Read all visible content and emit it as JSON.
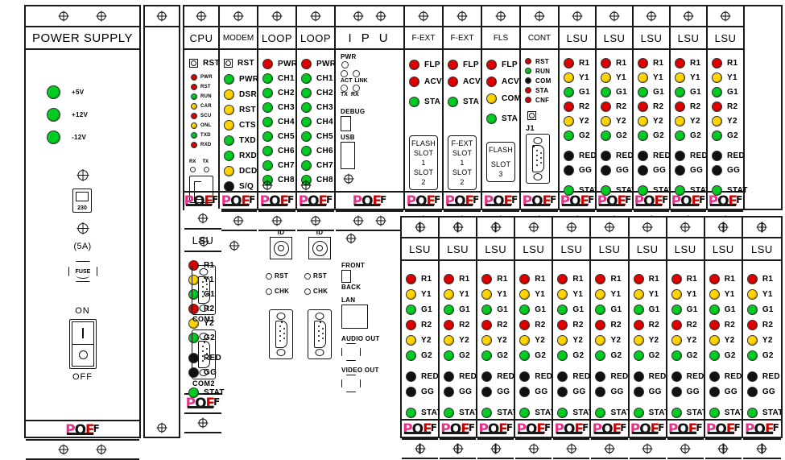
{
  "panel": {
    "brand_logo": {
      "p": "P",
      "o": "O",
      "e": "E",
      "f": "F"
    },
    "screw_icon": "screw-cross-icon"
  },
  "power_supply": {
    "title": "POWER SUPPLY",
    "leds": [
      {
        "label": "+5V",
        "color": "green"
      },
      {
        "label": "+12V",
        "color": "green"
      },
      {
        "label": "-12V",
        "color": "green"
      }
    ],
    "voltage_selector": {
      "value": "230"
    },
    "fuse": {
      "rating": "(5A)",
      "label": "FUSE"
    },
    "switch": {
      "on_label": "ON",
      "off_label": "OFF"
    }
  },
  "top_row": {
    "cpu": {
      "title": "CPU",
      "reset_label": "RST",
      "leds": [
        {
          "label": "PWR",
          "color": "red"
        },
        {
          "label": "RST",
          "color": "red"
        },
        {
          "label": "RUN",
          "color": "green"
        },
        {
          "label": "CAR",
          "color": "yellow"
        },
        {
          "label": "SCU",
          "color": "red"
        },
        {
          "label": "ONL",
          "color": "yellow"
        },
        {
          "label": "TXD",
          "color": "green"
        },
        {
          "label": "RXD",
          "color": "red"
        }
      ],
      "rx_label": "RX",
      "tx_label": "TX",
      "ethernet_port": "RJ45",
      "com1_label": "COM1",
      "com2_label": "COM2"
    },
    "modem": {
      "title": "MODEM",
      "reset_label": "RST",
      "leds": [
        {
          "label": "PWR",
          "color": "green"
        },
        {
          "label": "DSR",
          "color": "yellow"
        },
        {
          "label": "RST",
          "color": "yellow"
        },
        {
          "label": "CTS",
          "color": "yellow"
        },
        {
          "label": "TXD",
          "color": "green"
        },
        {
          "label": "RXD",
          "color": "green"
        },
        {
          "label": "DCD",
          "color": "yellow"
        },
        {
          "label": "S/Q",
          "color": "black"
        }
      ]
    },
    "loop1": {
      "title": "LOOP",
      "leds": [
        {
          "label": "PWR",
          "color": "red"
        },
        {
          "label": "CH1",
          "color": "green"
        },
        {
          "label": "CH2",
          "color": "green"
        },
        {
          "label": "CH3",
          "color": "green"
        },
        {
          "label": "CH4",
          "color": "green"
        },
        {
          "label": "CH5",
          "color": "green"
        },
        {
          "label": "CH6",
          "color": "green"
        },
        {
          "label": "CH7",
          "color": "green"
        },
        {
          "label": "CH8",
          "color": "green"
        }
      ],
      "id_label": "ID",
      "rst_label": "RST",
      "chk_label": "CHK"
    },
    "loop2": {
      "title": "LOOP",
      "leds": [
        {
          "label": "PWR",
          "color": "red"
        },
        {
          "label": "CH1",
          "color": "green"
        },
        {
          "label": "CH2",
          "color": "green"
        },
        {
          "label": "CH3",
          "color": "green"
        },
        {
          "label": "CH4",
          "color": "green"
        },
        {
          "label": "CH5",
          "color": "green"
        },
        {
          "label": "CH6",
          "color": "green"
        },
        {
          "label": "CH7",
          "color": "green"
        },
        {
          "label": "CH8",
          "color": "green"
        }
      ],
      "id_label": "ID",
      "rst_label": "RST",
      "chk_label": "CHK"
    },
    "ipu": {
      "title": "I P U",
      "pwr_label": "PWR",
      "act_label": "ACT",
      "link_label": "LINK",
      "tx_label": "TX",
      "rx_label": "RX",
      "debug_label": "DEBUG",
      "usb_label": "USB",
      "front_label": "FRONT",
      "back_label": "BACK",
      "lan_label": "LAN",
      "audio_out_label": "AUDIO OUT",
      "video_out_label": "VIDEO OUT"
    },
    "fext1": {
      "title": "F-EXT",
      "leds": [
        {
          "label": "FLP",
          "color": "red"
        },
        {
          "label": "ACV",
          "color": "red"
        },
        {
          "label": "STA",
          "color": "green"
        }
      ],
      "slot_lines": [
        "FLASH",
        "SLOT 1",
        "SLOT 2"
      ]
    },
    "fext2": {
      "title": "F-EXT",
      "leds": [
        {
          "label": "FLP",
          "color": "red"
        },
        {
          "label": "ACV",
          "color": "red"
        },
        {
          "label": "STA",
          "color": "green"
        }
      ],
      "slot_lines": [
        "F-EXT",
        "SLOT 1",
        "SLOT 2"
      ]
    },
    "fls": {
      "title": "FLS",
      "leds": [
        {
          "label": "FLP",
          "color": "red"
        },
        {
          "label": "ACV",
          "color": "red"
        },
        {
          "label": "COM",
          "color": "yellow"
        },
        {
          "label": "STA",
          "color": "green"
        }
      ],
      "slot_lines": [
        "FLASH",
        "SLOT 3"
      ]
    },
    "cont": {
      "title": "CONT",
      "leds": [
        {
          "label": "RST",
          "color": "red"
        },
        {
          "label": "RUN",
          "color": "green"
        },
        {
          "label": "COM",
          "color": "black"
        },
        {
          "label": "STA",
          "color": "red"
        },
        {
          "label": "CNF",
          "color": "red"
        }
      ],
      "connector_label": "J1"
    },
    "lsu_count": 6
  },
  "bottom_row": {
    "lsu_count": 10
  },
  "lsu_template": {
    "title": "LSU",
    "leds": [
      {
        "label": "R1",
        "color": "red"
      },
      {
        "label": "Y1",
        "color": "yellow"
      },
      {
        "label": "G1",
        "color": "green"
      },
      {
        "label": "R2",
        "color": "red"
      },
      {
        "label": "Y2",
        "color": "yellow"
      },
      {
        "label": "G2",
        "color": "green"
      },
      {
        "label": "RED",
        "color": "black"
      },
      {
        "label": "GG",
        "color": "black"
      },
      {
        "label": "STAT",
        "color": "green"
      }
    ]
  },
  "colors": {
    "led_red": "#e00000",
    "led_green": "#00cc22",
    "led_yellow": "#ffd400",
    "led_black": "#111111",
    "logo_pink": "#e8308a",
    "logo_red": "#cc0000",
    "frame": "#1a1a1a"
  }
}
